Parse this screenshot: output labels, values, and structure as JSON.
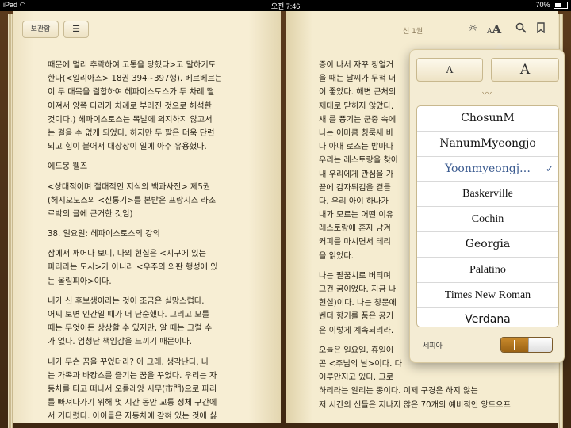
{
  "status": {
    "device": "iPad",
    "time": "오전 7:46",
    "battery": "70%",
    "battery_level": 0.7
  },
  "toolbar": {
    "library_label": "보관함",
    "toc_icon": "list-icon",
    "chapter": "신 1권",
    "brightness_icon": "brightness-icon",
    "font_small_glyph": "A",
    "font_large_glyph": "A",
    "search_icon": "search-icon",
    "bookmark_icon": "bookmark-icon"
  },
  "left_page": {
    "lines": [
      "때문에 멀리 추락하여 고통을 당했다>고 말하기도",
      "한다(<일리아스> 18권 394~397행). 베르베르는",
      "이 두 대목을 결합하여 헤파이스토스가 두 차례 떨",
      "어져서 양쪽 다리가 차례로 부러진 것으로 해석한",
      "것이다.) 헤파이스토스는 목발에 의지하지 않고서",
      "는 걸을 수 없게 되었다. 하지만 두 팔은 더욱 단련",
      "되고 힘이 붙어서 대장장이 일에 아주 유용했다.",
      "에드몽 웰즈",
      "<상대적이며 절대적인 지식의 백과사전> 제5권",
      "(헤시오도스의 <신통기>를 본받은 프랑시스 라조",
      "르박의 글에 근거한 것임)",
      "38. 일요일: 헤파이스토스의 강의",
      "잠에서 깨어나 보니, 나의 현실은 <지구에 있는",
      "파리라는 도시>가 아니라 <우주의 의판 행성에 있",
      "는 올림피아>이다.",
      "내가 신 후보생이라는 것이 조금은 실망스럽다.",
      "어찌 보면 인간일 때가 더 단순했다. 그리고 모를",
      "때는 무엇이든 상상할 수 있지만, 알 때는 그럴 수",
      "가 없다. 엄청난 책임감을 느끼기 때문이다.",
      "내가 무슨 꿈을 꾸었더라? 아 그래, 생각난다. 나",
      "는 가족과 바캉스를 즐기는 꿈을 꾸었다. 우리는 자",
      "동차를 타고 떠나서 오를레앙 시무(市門)으로 파리",
      "를 빠져나가기 위해 몇 시간 동안 교통 정체 구간에",
      "서 기다렸다. 아이들은 자동차에 갇혀 있는 것에 싫"
    ]
  },
  "right_page": {
    "lines": [
      "증이 나서 자꾸 칭얼거",
      "을 때는 날씨가 무척 더",
      "이 좋았다. 해변 근처의",
      "제대로 닫히지 않았다.",
      "새 를 풍기는 군중 속에",
      "나는 이마큼 칭룩새 바",
      "나 아내 로즈는 밤마다",
      "우리는 레스토랑을 찾아",
      "내 우리에게 관심을 가",
      "끝에 감자튀김을 곁들",
      "다. 우리 아이 하나가",
      "내가 모르는 어떤 이유",
      "레스토랑에 혼자 남겨",
      "커피를 마시면서 테리",
      "을 읽었다.",
      "나는 팔꿈치로 버티며",
      "그건 꿈이었다. 지금 나",
      "현실)이다. 나는 창문에",
      "벤더 향기를 품은 공기",
      "은 이렇게 계속되리라.",
      "오늘은 일요일, 휴일이",
      "곤 <주님의 날>이다. 다",
      "어루만지고 있다. 크로",
      "하리라는 알리는 종이다. 이제 구경은 하지 않는",
      "저 시간의 신들은 지나지 않은 70개의 예비적인 앙드으프"
    ]
  },
  "font_panel": {
    "size_small": "A",
    "size_large": "A",
    "ornament": "〰",
    "fonts": [
      {
        "name": "ChosunM",
        "selected": false
      },
      {
        "name": "NanumMyeongjo",
        "selected": false
      },
      {
        "name": "Yoonmyeongj…",
        "selected": true
      },
      {
        "name": "Baskerville",
        "selected": false
      },
      {
        "name": "Cochin",
        "selected": false
      },
      {
        "name": "Georgia",
        "selected": false
      },
      {
        "name": "Palatino",
        "selected": false
      },
      {
        "name": "Times New Roman",
        "selected": false
      },
      {
        "name": "Verdana",
        "selected": false
      }
    ],
    "check_glyph": "✓",
    "sepia_label": "세피아",
    "sepia_on": true,
    "accent": "#3a5a8f"
  }
}
